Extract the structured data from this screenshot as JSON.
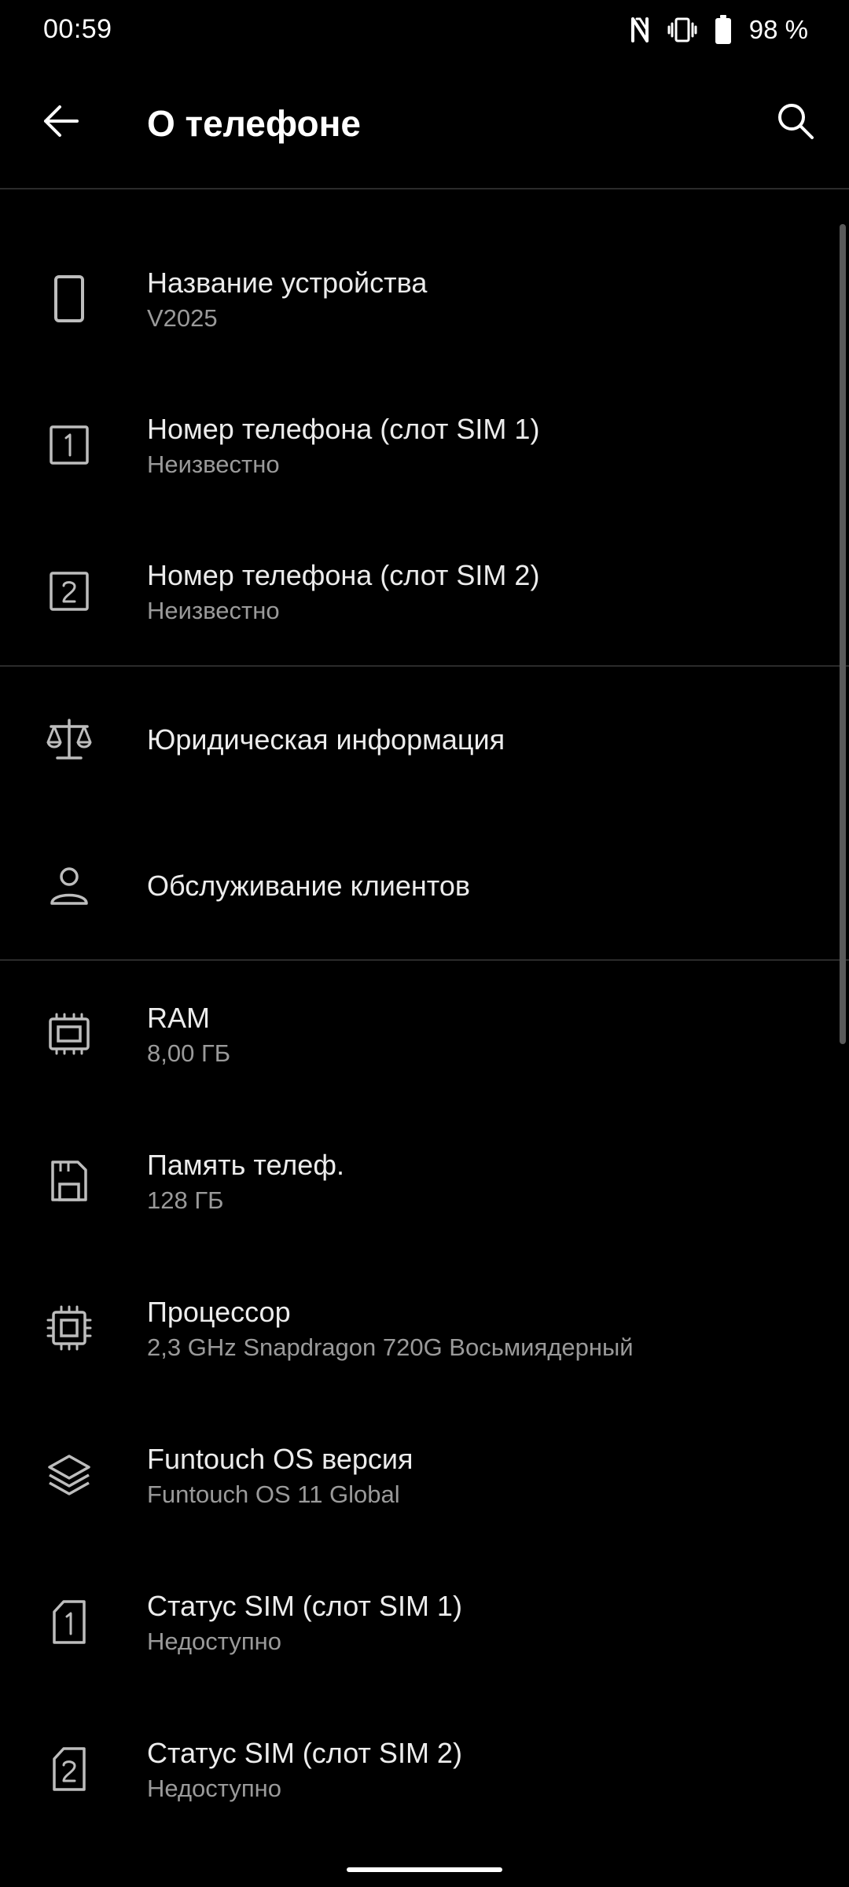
{
  "status_bar": {
    "time": "00:59",
    "battery_text": "98 %",
    "icons": [
      "nfc-icon",
      "vibrate-icon",
      "battery-icon"
    ]
  },
  "app_bar": {
    "title": "О телефоне",
    "back_icon": "arrow-left-icon",
    "search_icon": "search-icon"
  },
  "items": [
    {
      "icon": "phone-icon",
      "title": "Название устройства",
      "subtitle": "V2025"
    },
    {
      "icon": "sim-slot-1-icon",
      "title": "Номер телефона (слот SIM 1)",
      "subtitle": "Неизвестно"
    },
    {
      "icon": "sim-slot-2-icon",
      "title": "Номер телефона (слот SIM 2)",
      "subtitle": "Неизвестно"
    },
    {
      "icon": "scales-icon",
      "title": "Юридическая информация",
      "subtitle": ""
    },
    {
      "icon": "person-icon",
      "title": "Обслуживание клиентов",
      "subtitle": ""
    },
    {
      "icon": "memory-chip-icon",
      "title": "RAM",
      "subtitle": "8,00 ГБ"
    },
    {
      "icon": "storage-icon",
      "title": "Память телеф.",
      "subtitle": "128 ГБ"
    },
    {
      "icon": "processor-icon",
      "title": "Процессор",
      "subtitle": "2,3 GHz Snapdragon 720G Восьмиядерный"
    },
    {
      "icon": "layers-icon",
      "title": "Funtouch OS версия",
      "subtitle": "Funtouch OS 11 Global"
    },
    {
      "icon": "sim-card-1-icon",
      "title": "Статус SIM (слот SIM 1)",
      "subtitle": "Недоступно"
    },
    {
      "icon": "sim-card-2-icon",
      "title": "Статус SIM (слот SIM 2)",
      "subtitle": "Недоступно"
    }
  ]
}
